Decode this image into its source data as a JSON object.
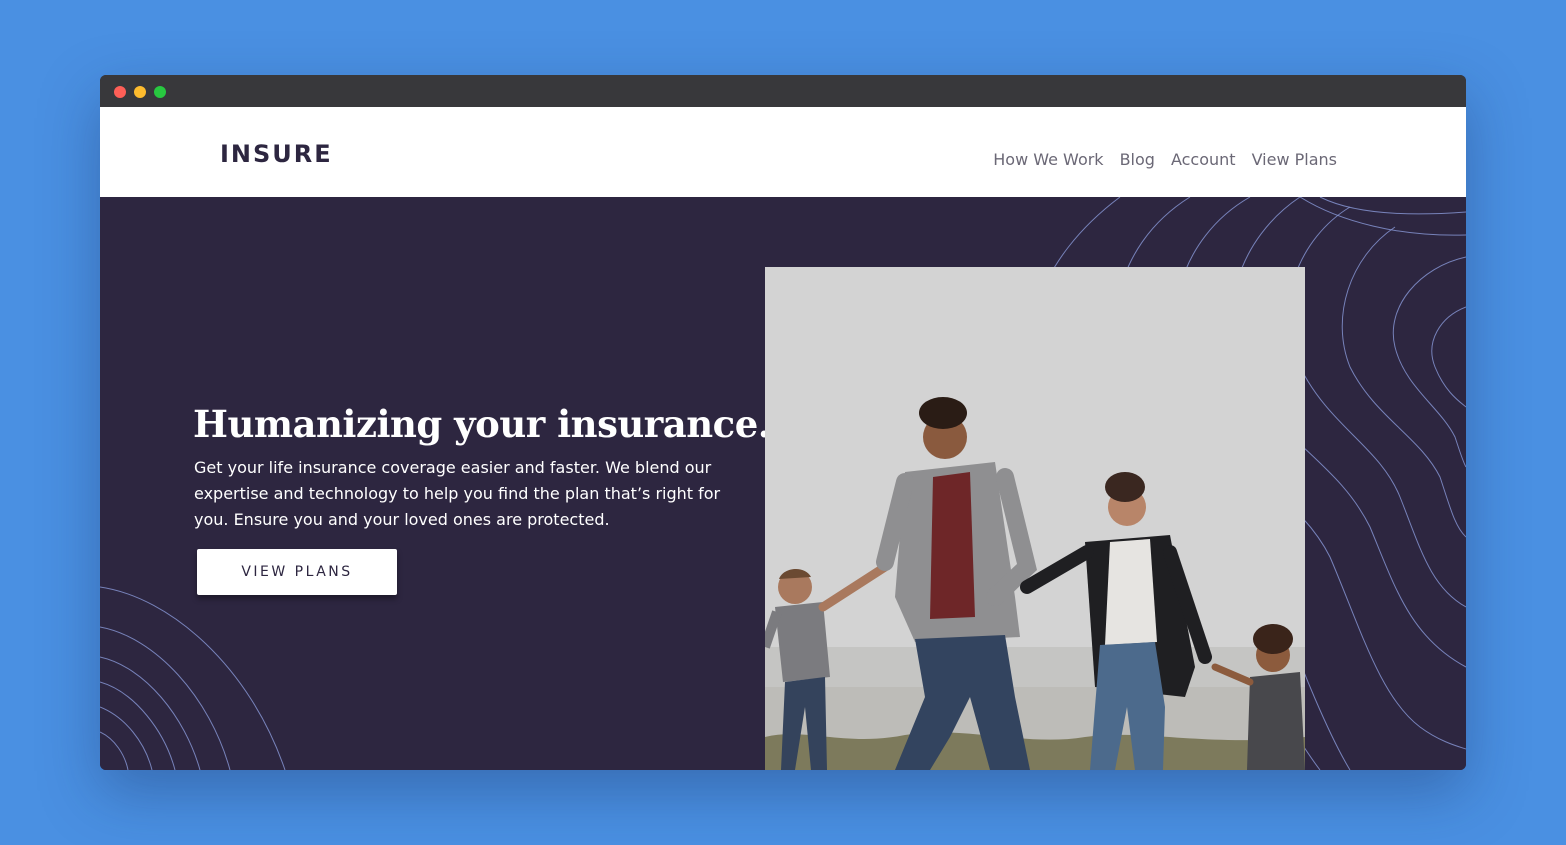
{
  "window": {
    "controls": [
      "close",
      "minimize",
      "maximize"
    ],
    "colors": {
      "close": "#fe5f57",
      "minimize": "#febc2e",
      "maximize": "#28c840"
    }
  },
  "header": {
    "logo": "INSURE",
    "nav": [
      "How We Work",
      "Blog",
      "Account",
      "View Plans"
    ]
  },
  "hero": {
    "title": "Humanizing your insurance.",
    "text": "Get your life insurance coverage easier and faster. We blend our expertise and technology to help you find the plan that’s right for you. Ensure you and your loved ones are protected.",
    "button_label": "VIEW PLANS",
    "image_icon": "family-photo"
  },
  "colors": {
    "background": "#4a90e2",
    "hero_bg": "#2d2640",
    "header_bg": "#ffffff",
    "nav_text": "#6b6876",
    "contour_lines": "#8a9ad8"
  }
}
